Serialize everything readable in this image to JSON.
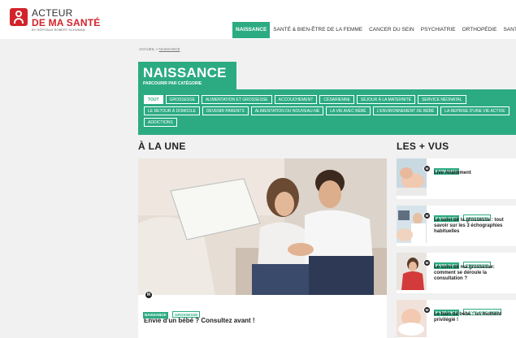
{
  "header": {
    "logo": {
      "line1": "ACTEUR",
      "line2": "DE MA SANTÉ",
      "line3": "BY HÔPITAUX ROBERT SCHUMAN"
    },
    "nav": [
      {
        "label": "NAISSANCE",
        "active": true
      },
      {
        "label": "SANTÉ & BIEN-ÊTRE DE LA FEMME",
        "active": false
      },
      {
        "label": "CANCER DU SEIN",
        "active": false
      },
      {
        "label": "PSYCHIATRIE",
        "active": false
      },
      {
        "label": "ORTHOPÉDIE",
        "active": false
      },
      {
        "label": "SANT",
        "active": false
      }
    ]
  },
  "breadcrumb": {
    "home": "ACCUEIL",
    "sep": ">",
    "current": "NAISSANCE"
  },
  "category": {
    "title": "NAISSANCE",
    "subtitle": "PARCOURIR PAR CATÉGORIE",
    "tags": [
      {
        "label": "TOUT",
        "active": true
      },
      {
        "label": "GROSSESSE"
      },
      {
        "label": "ALIMENTATION ET GROSSESSE"
      },
      {
        "label": "ACCOUCHEMENT"
      },
      {
        "label": "CÉSARIENNE"
      },
      {
        "label": "SÉJOUR À LA MATERNITÉ"
      },
      {
        "label": "SERVICE NÉONATAL"
      },
      {
        "label": "LE RETOUR À DOMICILE"
      },
      {
        "label": "DEVENIR PARENTS"
      },
      {
        "label": "ALIMENTATION DU NOUVEAU-NÉ"
      },
      {
        "label": "LA VIE AVEC BÉBÉ"
      },
      {
        "label": "L'ENVIRONNEMENT DE BÉBÉ"
      },
      {
        "label": "LA REPRISE D'UNE VIE ACTIVE"
      },
      {
        "label": "ADDICTIONS"
      }
    ]
  },
  "featured": {
    "section_title": "À LA UNE",
    "play_label": "M",
    "tags": [
      "NAISSANCE",
      "GROSSESSE"
    ],
    "title": "Envie d'un bébé ? Consultez avant !"
  },
  "side": {
    "section_title": "LES + VUS",
    "items": [
      {
        "tags": [
          "NAISSANCE"
        ],
        "title": "Live Allaitement",
        "play": "M"
      },
      {
        "tags": [
          "NAISSANCE",
          "GROSSESSE"
        ],
        "title": "Le suivi de la grossesse : tout savoir sur les 3 échographies habituelles",
        "play": "M"
      },
      {
        "tags": [
          "NAISSANCE",
          "GROSSESSE"
        ],
        "title": "Le suivi de ma grossesse: comment se déroule la consultation ?",
        "play": "M"
      },
      {
        "tags": [
          "NAISSANCE",
          "LA VIE AVEC BÉBÉ"
        ],
        "title": "Le bain de bébé : un moment privilégié !",
        "play": "M"
      }
    ]
  },
  "colors": {
    "brand_red": "#d2232a",
    "accent_green": "#2cab82"
  }
}
